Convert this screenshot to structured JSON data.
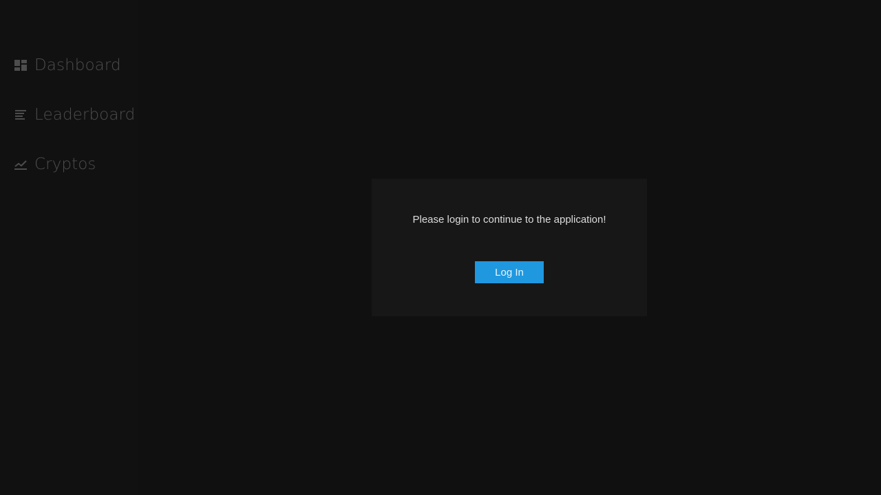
{
  "sidebar": {
    "items": [
      {
        "label": "Dashboard",
        "icon": "dashboard-icon"
      },
      {
        "label": "Leaderboard",
        "icon": "leaderboard-icon"
      },
      {
        "label": "Cryptos",
        "icon": "trending-up-icon"
      }
    ]
  },
  "login": {
    "message": "Please login to continue to the application!",
    "button_label": "Log In"
  },
  "colors": {
    "background": "#101010",
    "card": "#171717",
    "accent": "#1f98e0",
    "nav_text": "#4d4d4d"
  }
}
